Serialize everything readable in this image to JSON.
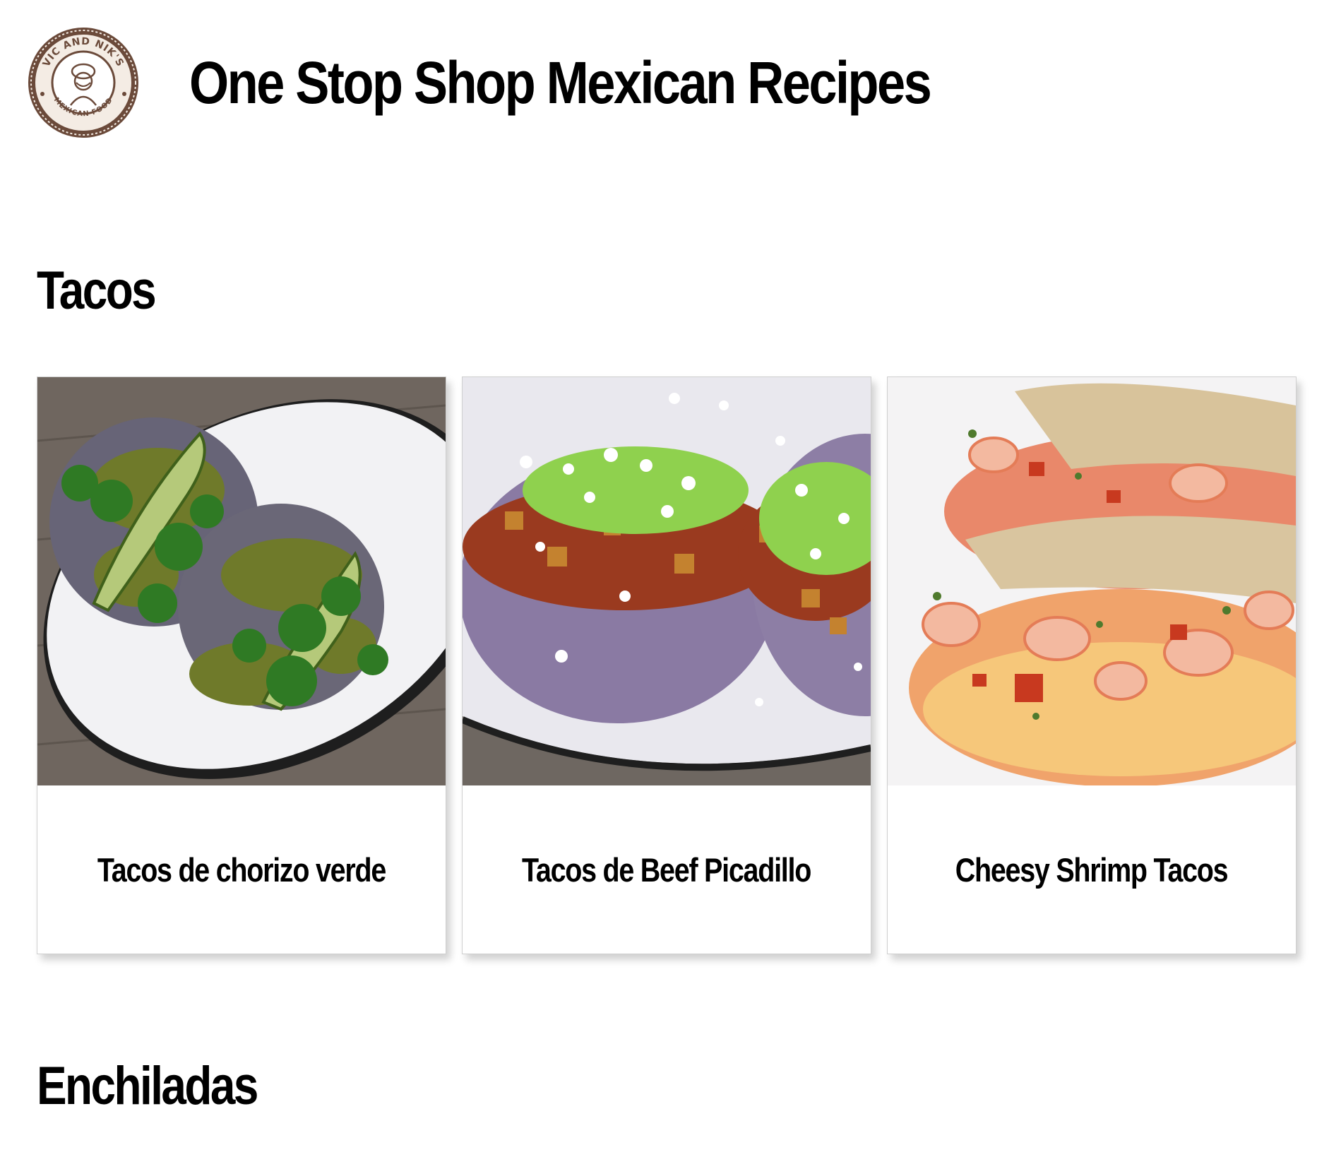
{
  "header": {
    "logo": {
      "name": "vic-and-niks-logo",
      "top_text": "VIC AND NIK'S",
      "bottom_text": "MEXICAN FOOD"
    },
    "title": "One Stop Shop Mexican Recipes"
  },
  "sections": [
    {
      "heading": "Tacos",
      "cards": [
        {
          "title": "Tacos de chorizo verde",
          "image": "chorizo-verde-tacos-photo"
        },
        {
          "title": "Tacos de Beef Picadillo",
          "image": "beef-picadillo-tacos-photo"
        },
        {
          "title": "Cheesy Shrimp Tacos",
          "image": "cheesy-shrimp-tacos-photo"
        }
      ]
    },
    {
      "heading": "Enchiladas",
      "cards": []
    }
  ],
  "colors": {
    "background": "#ffffff",
    "text": "#000000",
    "card_border": "#cfcfcf",
    "logo_brown": "#6b4a3a"
  }
}
